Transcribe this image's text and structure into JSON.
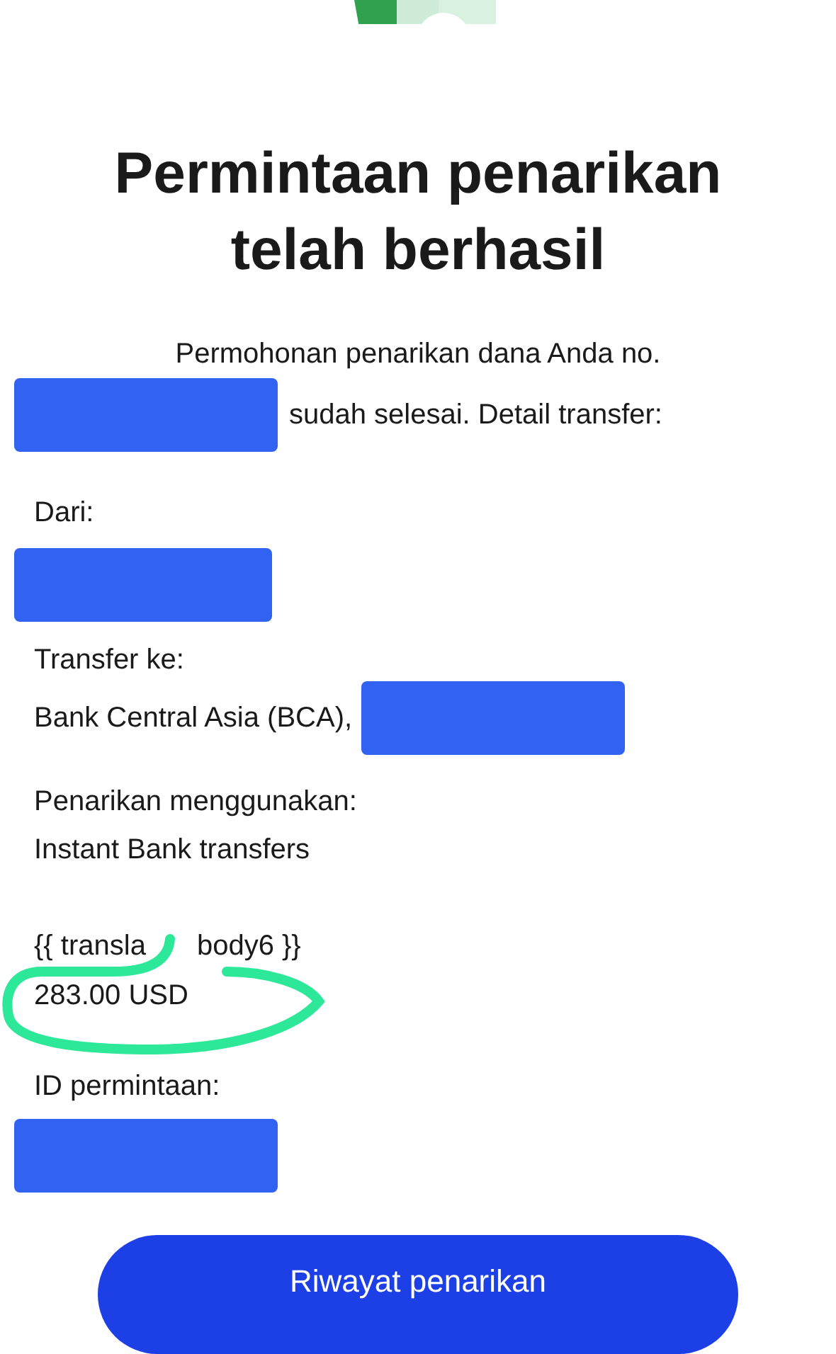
{
  "title": "Permintaan penarikan telah berhasil",
  "message": {
    "line1": "Permohonan penarikan dana Anda no.",
    "line2": "sudah selesai. Detail transfer:"
  },
  "from": {
    "label": "Dari:"
  },
  "transfer_to": {
    "label": "Transfer ke:",
    "value": "Bank Central Asia (BCA),"
  },
  "method": {
    "label": "Penarikan menggunakan:",
    "value": "Instant Bank transfers"
  },
  "amount": {
    "label_start": "{{ transla",
    "label_end": "body6 }}",
    "value": "283.00 USD"
  },
  "request_id": {
    "label": "ID permintaan:"
  },
  "button": "Riwayat penarikan"
}
